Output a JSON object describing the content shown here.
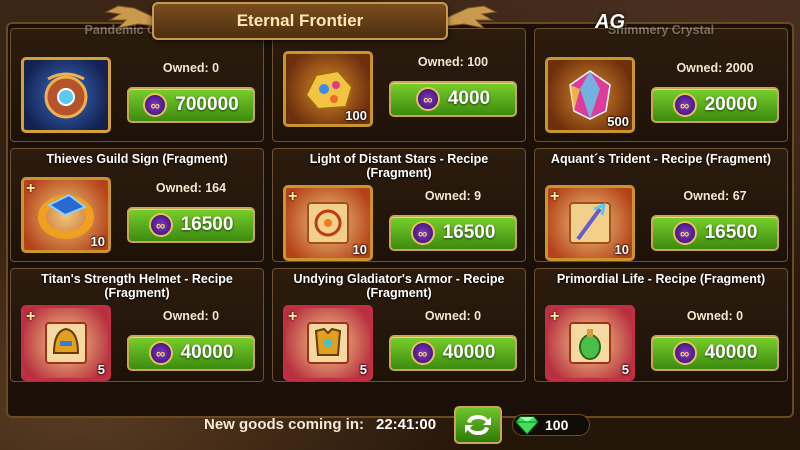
{
  "window": {
    "title": "Eternal Frontier",
    "logo_text": "AG"
  },
  "currency_icon_symbol": "∞",
  "cards": [
    {
      "title": "Pandemic Canary",
      "owned": "Owned: 0",
      "price": "700000",
      "qty": "",
      "art": "pendant-icon",
      "frame": "blue",
      "has_plus": false
    },
    {
      "title": "",
      "owned": "Owned: 100",
      "price": "4000",
      "qty": "100",
      "art": "gold-ore-icon",
      "frame": "gold",
      "has_plus": false
    },
    {
      "title": "Shimmery Crystal",
      "owned": "Owned: 2000",
      "price": "20000",
      "qty": "500",
      "art": "crystal-icon",
      "frame": "gold",
      "has_plus": false
    },
    {
      "title": "Thieves Guild Sign (Fragment)",
      "owned": "Owned: 164",
      "price": "16500",
      "qty": "10",
      "art": "ring-icon",
      "frame": "scroll",
      "has_plus": true
    },
    {
      "title": "Light of Distant Stars - Recipe (Fragment)",
      "owned": "Owned: 9",
      "price": "16500",
      "qty": "10",
      "art": "recipe-scroll-icon",
      "frame": "scroll",
      "has_plus": true
    },
    {
      "title": "Aquant´s Trident - Recipe (Fragment)",
      "owned": "Owned: 67",
      "price": "16500",
      "qty": "10",
      "art": "trident-icon",
      "frame": "scroll",
      "has_plus": true
    },
    {
      "title": "Titan's Strength Helmet - Recipe (Fragment)",
      "owned": "Owned: 0",
      "price": "40000",
      "qty": "5",
      "art": "helmet-icon",
      "frame": "scroll-red",
      "has_plus": true
    },
    {
      "title": "Undying Gladiator's Armor - Recipe (Fragment)",
      "owned": "Owned: 0",
      "price": "40000",
      "qty": "5",
      "art": "armor-icon",
      "frame": "scroll-red",
      "has_plus": true
    },
    {
      "title": "Primordial Life - Recipe (Fragment)",
      "owned": "Owned: 0",
      "price": "40000",
      "qty": "5",
      "art": "potion-icon",
      "frame": "scroll-red",
      "has_plus": true
    }
  ],
  "footer": {
    "timer_label": "New goods coming in:",
    "timer_value": "22:41:00",
    "gem_count": "100"
  },
  "colors": {
    "button_green": "#5fb51e",
    "frame_gold": "#c9962e",
    "banner_brown": "#6a4219"
  }
}
